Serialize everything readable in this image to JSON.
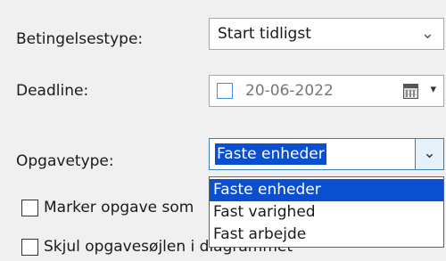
{
  "condition_type": {
    "label": "Betingelsestype:",
    "value": "Start tidligst"
  },
  "deadline": {
    "label": "Deadline:",
    "value": "20-06-2022"
  },
  "task_type": {
    "label": "Opgavetype:",
    "value": "Faste enheder",
    "options": [
      "Faste enheder",
      "Fast varighed",
      "Fast arbejde"
    ],
    "selected_index": 0
  },
  "checkboxes": [
    {
      "label": "Marker opgave som",
      "checked": false
    },
    {
      "label": "Skjul opgavesøjlen i diagrammet",
      "checked": false
    }
  ],
  "colors": {
    "highlight": "#0a4fd0",
    "background": "#f0f0f0",
    "combo_border_focused": "#3c7fb1"
  },
  "icons": [
    "chevron-down-icon",
    "calendar-icon",
    "dropdown-triangle-icon"
  ]
}
